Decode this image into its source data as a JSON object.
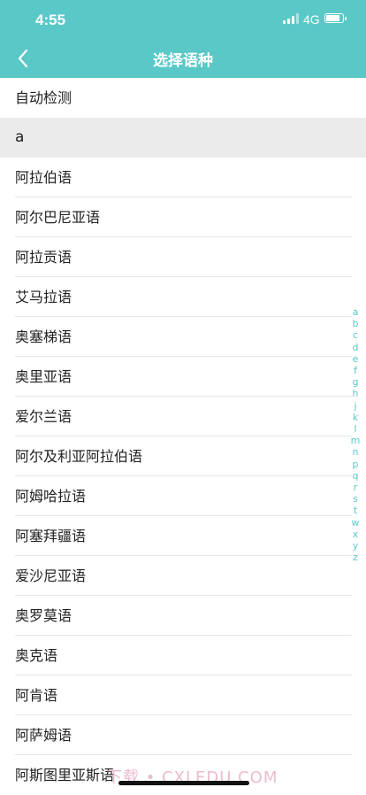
{
  "status_bar": {
    "time": "4:55",
    "network": "4G"
  },
  "nav": {
    "title": "选择语种"
  },
  "auto_detect_label": "自动检测",
  "section": {
    "letter": "a",
    "languages": [
      "阿拉伯语",
      "阿尔巴尼亚语",
      "阿拉贡语",
      "艾马拉语",
      "奥塞梯语",
      "奥里亚语",
      "爱尔兰语",
      "阿尔及利亚阿拉伯语",
      "阿姆哈拉语",
      "阿塞拜疆语",
      "爱沙尼亚语",
      "奥罗莫语",
      "奥克语",
      "阿肯语",
      "阿萨姆语",
      "阿斯图里亚斯语"
    ]
  },
  "index_letters": [
    "a",
    "b",
    "c",
    "d",
    "e",
    "f",
    "g",
    "h",
    "j",
    "k",
    "l",
    "m",
    "n",
    "p",
    "q",
    "r",
    "s",
    "t",
    "w",
    "x",
    "y",
    "z"
  ],
  "watermark": "下载 • CXLEDU.COM",
  "colors": {
    "accent": "#5bc8c8",
    "section_bg": "#ebebeb"
  }
}
